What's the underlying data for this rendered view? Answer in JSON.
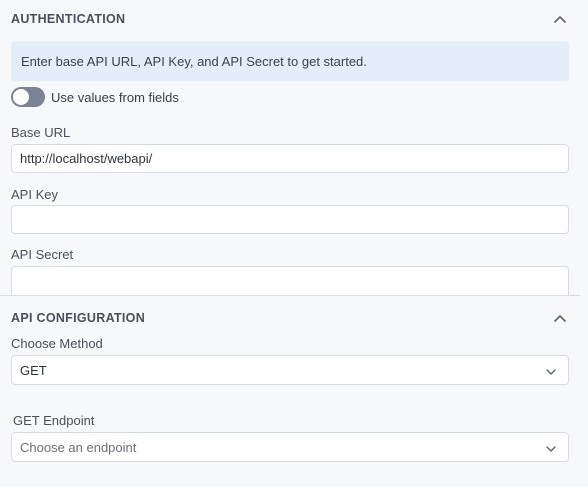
{
  "authentication": {
    "title": "AUTHENTICATION",
    "info": "Enter base API URL, API Key, and API Secret to get started.",
    "toggle_label": "Use values from fields",
    "toggle_on": false,
    "base_url": {
      "label": "Base URL",
      "value": "http://localhost/webapi/"
    },
    "api_key": {
      "label": "API Key",
      "value": ""
    },
    "api_secret": {
      "label": "API Secret",
      "value": ""
    }
  },
  "api_configuration": {
    "title": "API CONFIGURATION",
    "method": {
      "label": "Choose Method",
      "value": "GET"
    },
    "endpoint": {
      "label": "GET Endpoint",
      "placeholder": "Choose an endpoint"
    }
  },
  "icons": {
    "collapse": "chevron-up-icon",
    "dropdown": "chevron-down-icon"
  }
}
